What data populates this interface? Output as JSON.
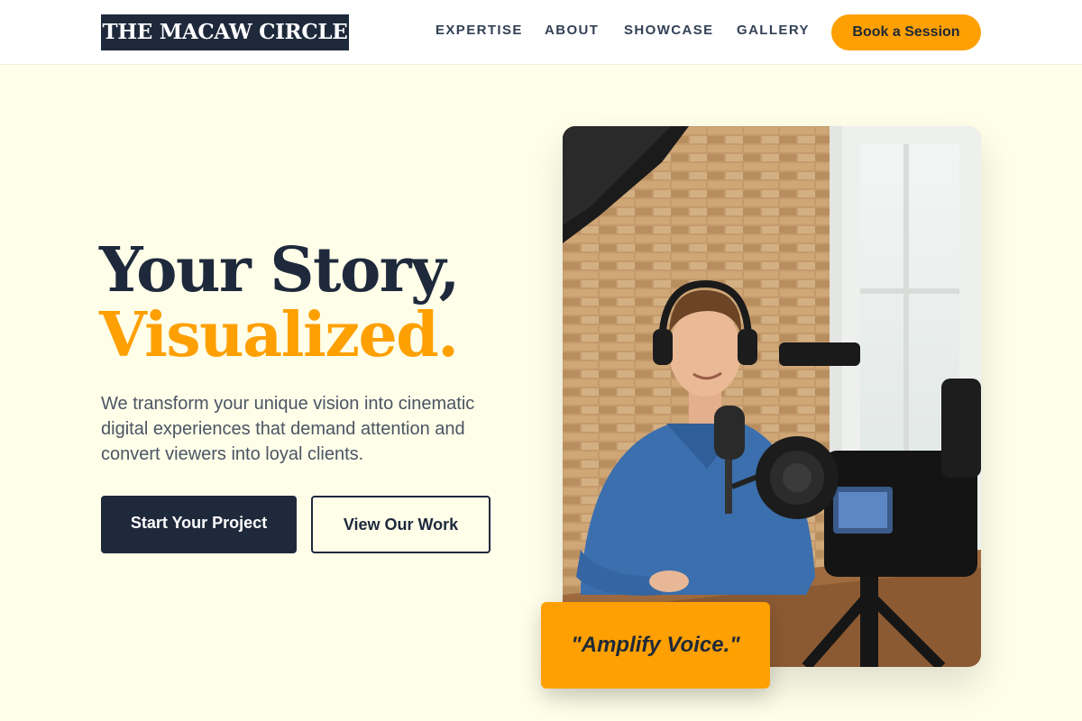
{
  "header": {
    "logo_text": "THE MACAW CIRCLE",
    "nav": [
      "EXPERTISE",
      "ABOUT",
      "SHOWCASE",
      "GALLERY"
    ],
    "cta_label": "Book a Session"
  },
  "hero": {
    "headline_line1": "Your Story,",
    "headline_line2": "Visualized.",
    "subtext": "We transform your unique vision into cinematic digital experiences that demand attention and convert viewers into loyal clients.",
    "primary_button": "Start Your Project",
    "secondary_button": "View Our Work",
    "quote": "\"Amplify Voice.\""
  },
  "colors": {
    "navy": "#1e293b",
    "accent": "#fea002",
    "background": "#fefee9"
  },
  "image": {
    "subject": "man-with-headphones-at-podcast-microphone-with-camera"
  }
}
